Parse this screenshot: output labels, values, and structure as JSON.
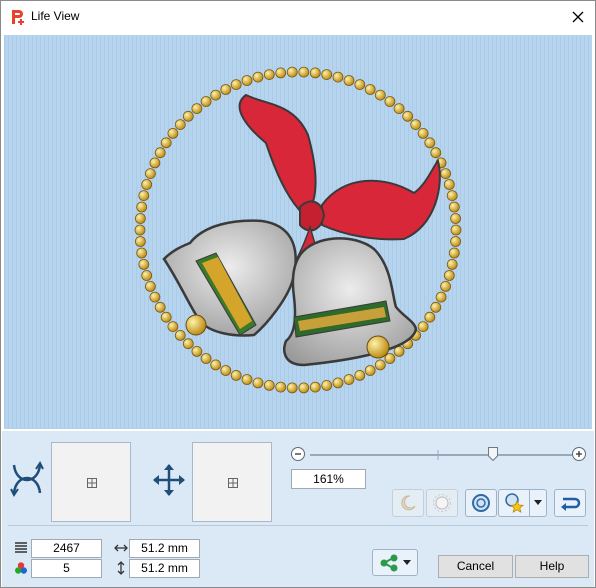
{
  "window": {
    "title": "Life View",
    "accent_color": "#e8412c"
  },
  "preview": {
    "background_color": "#b7d4ef",
    "image_description_icon": "christmas-bells-embroidery"
  },
  "zoom": {
    "value_label": "161%",
    "slider_fraction": 0.7
  },
  "stats": {
    "stitches": "2467",
    "colors": "5",
    "width": "51.2 mm",
    "height": "51.2 mm"
  },
  "buttons": {
    "cancel": "Cancel",
    "help": "Help"
  }
}
